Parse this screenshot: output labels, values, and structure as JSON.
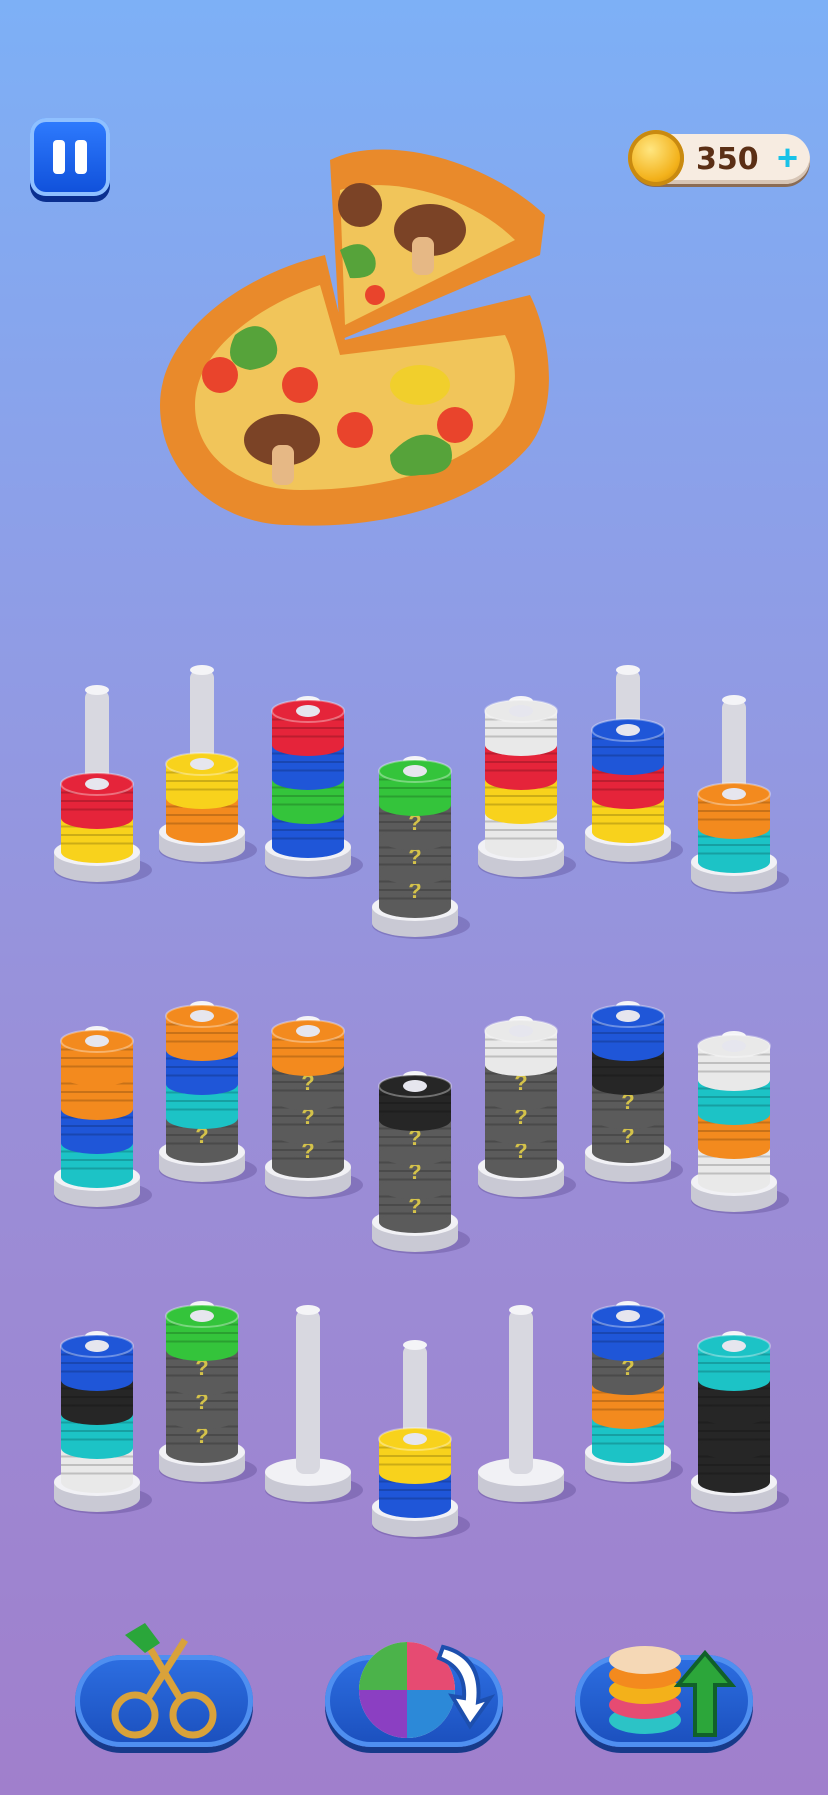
{
  "hud": {
    "coins": "350",
    "plus_symbol": "+"
  },
  "icons": {
    "pause": "pause-icon",
    "coin": "coin-icon",
    "add": "plus-icon",
    "scissors": "scissors-icon",
    "shuffle": "shuffle-icon",
    "extra_pole": "extra-pole-icon"
  },
  "colors": {
    "red": "#e5243a",
    "yellow": "#f8d21c",
    "orange": "#f38a1e",
    "blue": "#1f56d8",
    "green": "#34c43b",
    "teal": "#1cc3c6",
    "white": "#e9e9e9",
    "black": "#262626",
    "hidden": "#5b5b5b"
  },
  "hidden_mark": "?",
  "rows": [
    [
      [
        "yellow",
        "red"
      ],
      [
        "orange",
        "yellow"
      ],
      [
        "blue",
        "green",
        "blue",
        "red"
      ],
      [
        "hidden",
        "hidden",
        "hidden",
        "green"
      ],
      [
        "white",
        "yellow",
        "red",
        "white"
      ],
      [
        "yellow",
        "red",
        "blue"
      ],
      [
        "teal",
        "orange"
      ]
    ],
    [
      [
        "teal",
        "blue",
        "orange",
        "orange"
      ],
      [
        "hidden",
        "teal",
        "blue",
        "orange"
      ],
      [
        "hidden",
        "hidden",
        "hidden",
        "orange"
      ],
      [
        "hidden",
        "hidden",
        "hidden",
        "black"
      ],
      [
        "hidden",
        "hidden",
        "hidden",
        "white"
      ],
      [
        "hidden",
        "hidden",
        "black",
        "blue"
      ],
      [
        "white",
        "orange",
        "teal",
        "white"
      ]
    ],
    [
      [
        "white",
        "teal",
        "black",
        "blue"
      ],
      [
        "hidden",
        "hidden",
        "hidden",
        "green"
      ],
      [],
      [
        "blue",
        "yellow"
      ],
      [],
      [
        "teal",
        "orange",
        "hidden",
        "blue"
      ],
      [
        "black",
        "black",
        "black",
        "teal"
      ]
    ]
  ]
}
